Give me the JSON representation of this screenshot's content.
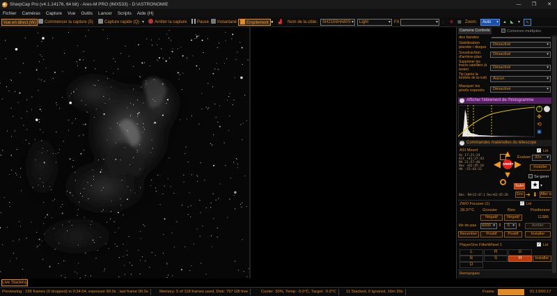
{
  "window": {
    "title": "SharpCap Pro (v4.1.14176, 64 bit) - Ares-M PRO (IMX533) - D:\\ASTRONOMIE",
    "min": "—",
    "restore": "❐",
    "close": "✕"
  },
  "menu": [
    "Fichier",
    "Caméras",
    "Capture",
    "Vue",
    "Outils",
    "Lancer",
    "Scripts",
    "Aide (H)"
  ],
  "toolbar": {
    "live_view": "Vue en direct (W)",
    "start_capture": "Commencer la capture (5)",
    "quick_capture": "Capture rapide (Q)",
    "stop_capture": "Arrêter la capture",
    "pause": "Pause",
    "snapshot": "Instantané",
    "stacking": "Empilement",
    "target_label": "Nom de la cible:",
    "target_value": "SH2155HA80S",
    "colormap_value": "Light",
    "fx_label": "FX",
    "fx_value": "",
    "zoom_label": "Zoom:",
    "zoom_value": "Auto"
  },
  "panel": {
    "tab_controls": "Camera Controls",
    "tab_multiple": "Colonnes multiples",
    "partial_row": "des bandes",
    "rows": [
      {
        "label": "Stabilisation planète / disque",
        "value": "Désactivé"
      },
      {
        "label": "Soustraction d'arrière-plan",
        "value": "Désactivé"
      },
      {
        "label": "Supprimer les traces satellites (à tester)",
        "value": "Désactivé"
      },
      {
        "label": "Tip (après la tombée de la nuit)",
        "value": "Aucun"
      },
      {
        "label": "Masquer les pixels exposés",
        "value": "Désactivé"
      }
    ],
    "histogram_header": "Afficher l'étirement de l'histogramme",
    "telescope_header": "Commandes matérielles du télescope",
    "mount": {
      "name": "ASI Mount",
      "lock": "Lié",
      "rate_label": "Évaluer:",
      "rate_value": "32x",
      "stop": "ARRÊT",
      "install": "Installer",
      "follow": "Suivi",
      "enc": "Enc",
      "goto": "Aller à",
      "disable_label": "Se garer",
      "coords": [
        "Az   17:21:24",
        "Alt  +41:27:43",
        "RA   21:57:46",
        "Dec  +62:45:16",
        "HA   -15:43:11"
      ],
      "status_line": "Obs: RA+22:47:1 Dec+62:45:20"
    },
    "focuser": {
      "name": "ZWO Focuser (1)",
      "lock": "Lié",
      "temp": "28.37°C",
      "coarse": "Grossier",
      "fine": "Bien",
      "position_label": "Positionner",
      "neg1": "Négatif",
      "neg2": "Négatif",
      "position_value": "11386",
      "step_label": "ille de pas",
      "step_coarse": "6000",
      "step_fine": "5",
      "stop": "Arrêter",
      "recenter": "Recentrer",
      "pos1": "Positif",
      "pos2": "Positif",
      "install": "Installer"
    },
    "filterwheel": {
      "name": "PlayerOne FilterWheel 1",
      "lock": "Lié",
      "filters": [
        "L",
        "R",
        "G",
        "B",
        "S",
        "H",
        "O"
      ],
      "active": "H",
      "install": "Installer"
    },
    "notes_label": "Remarques"
  },
  "live_stacking_tab": "Live Stacking",
  "status": {
    "previewing": "Previewing : 195 frames (0 dropped) in 0:24:04, exposure 90.0s , last frame 90.0s",
    "memory": "Memory: 5 of 118 frames used, Disk: 797 GB free",
    "cooler": "Cooler: 30%, Temp: -5.0°C, Target: -5.0°C",
    "stacked": "11 Stacked, 0 Ignored, 16m 30s",
    "frame_label": "Frame :",
    "frame_progress": 1.0,
    "time": "01:13/00:17"
  },
  "colors": {
    "accent": "#e08a2a",
    "highlight": "#5a2266",
    "stop_red": "#e02020",
    "arrow_orange": "#f09a20"
  }
}
